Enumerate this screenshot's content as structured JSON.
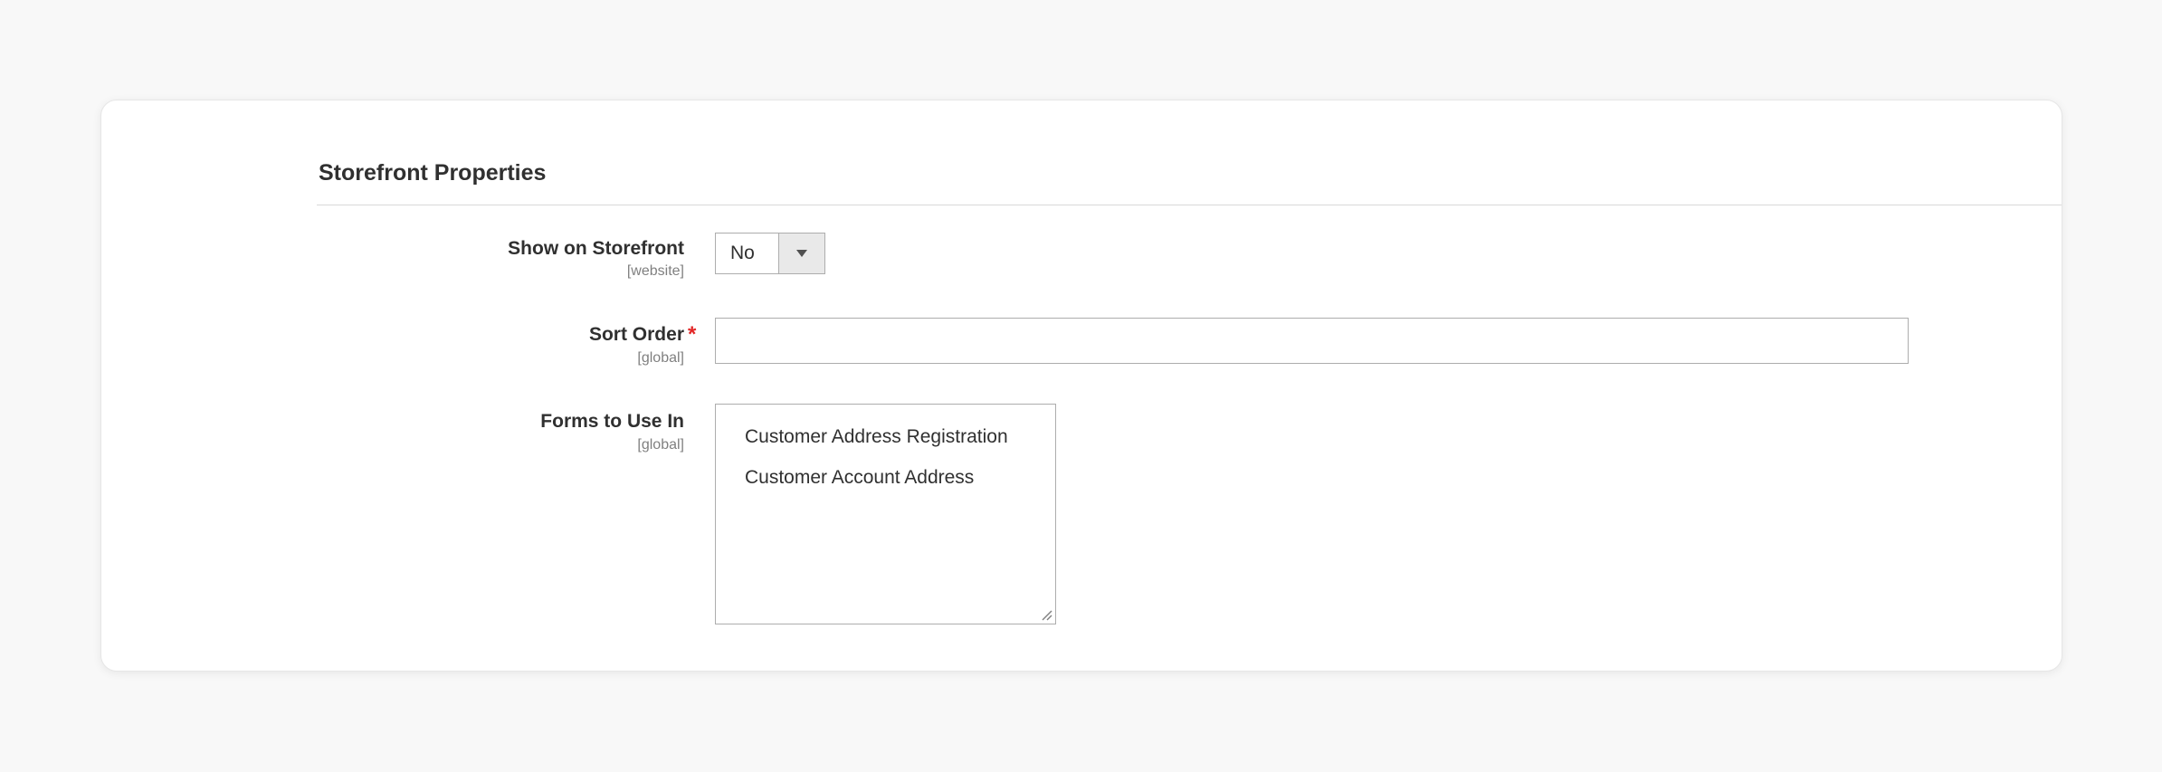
{
  "section": {
    "title": "Storefront Properties"
  },
  "fields": {
    "show_on_storefront": {
      "label": "Show on Storefront",
      "scope": "[website]",
      "value": "No"
    },
    "sort_order": {
      "label": "Sort Order",
      "scope": "[global]",
      "required_mark": "*",
      "value": ""
    },
    "forms_to_use_in": {
      "label": "Forms to Use In",
      "scope": "[global]",
      "options": [
        "Customer Address Registration",
        "Customer Account Address"
      ]
    }
  },
  "colors": {
    "required": "#e22626",
    "border": "#adadad",
    "page_background": "#f8f8f8"
  }
}
